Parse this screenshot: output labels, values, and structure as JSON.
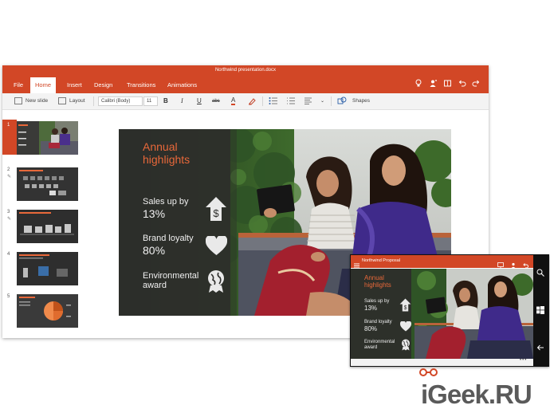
{
  "window": {
    "doc_title": "Northwind presentation.docx",
    "tabs": [
      {
        "label": "File"
      },
      {
        "label": "Home",
        "active": true
      },
      {
        "label": "Insert"
      },
      {
        "label": "Design"
      },
      {
        "label": "Transitions"
      },
      {
        "label": "Animations"
      }
    ],
    "title_icons": [
      "lightbulb-icon",
      "share-person-icon",
      "book-icon",
      "undo-icon",
      "redo-icon"
    ]
  },
  "ribbon": {
    "new_slide": "New slide",
    "layout": "Layout",
    "font_family": "Calibri (Body)",
    "font_size": "11",
    "bold": "B",
    "italic": "I",
    "underline": "U",
    "strike": "abc",
    "font_color": "A",
    "shapes": "Shapes"
  },
  "thumbnails": [
    {
      "num": "1",
      "active": true
    },
    {
      "num": "2"
    },
    {
      "num": "3"
    },
    {
      "num": "4"
    },
    {
      "num": "5"
    }
  ],
  "slide": {
    "heading_line1": "Annual",
    "heading_line2": "highlights",
    "item1_line1": "Sales up by",
    "item1_line2": "13%",
    "item2_line1": "Brand loyalty",
    "item2_line2": "80%",
    "item3_line1": "Environmental",
    "item3_line2": "award"
  },
  "tablet": {
    "doc_title": "Northwind Proposal",
    "dots": "•••"
  },
  "watermark": "iGeek.RU",
  "colors": {
    "accent": "#d24726",
    "slide_heading": "#e8683a",
    "slide_panel": "#3a3a38"
  }
}
